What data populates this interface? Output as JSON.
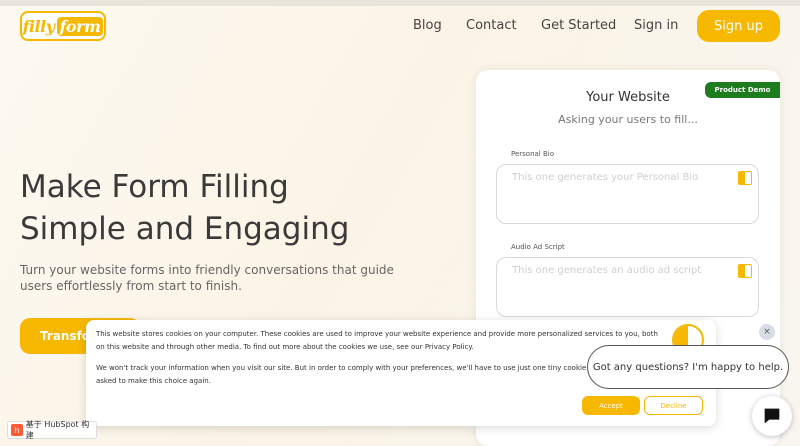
{
  "header": {
    "logo_left": "filly",
    "logo_right": "form",
    "nav": [
      "Blog",
      "Contact",
      "Get Started",
      "Sign in"
    ],
    "signup": "Sign up"
  },
  "hero": {
    "title_line1": "Make Form Filling",
    "title_line2": "Simple and Engaging",
    "subtitle": "Turn your website forms into friendly conversations that guide users effortlessly from start to finish.",
    "cta": "Transfor"
  },
  "demo": {
    "badge": "Product Demo",
    "title": "Your Website",
    "subtitle": "Asking your users to fill...",
    "fields": [
      {
        "label": "Personal Bio",
        "placeholder": "This one generates your Personal Bio"
      },
      {
        "label": "Audio Ad Script",
        "placeholder": "This one generates an audio ad script"
      }
    ]
  },
  "cookie": {
    "text1": "This website stores cookies on your computer. These cookies are used to improve your website experience and provide more personalized services to you, both on this website and through other media. To find out more about the cookies we use, see our Privacy Policy.",
    "text2": "We won't track your information when you visit our site. But in order to comply with your preferences, we'll have to use just one tiny cookie so that you're not asked to make this choice again.",
    "accept": "Accept",
    "decline": "Decline"
  },
  "chat": {
    "bubble": "Got any questions? I'm happy to help.",
    "close": "×"
  },
  "hubspot": {
    "label": "基于 HubSpot 构建"
  },
  "colors": {
    "accent": "#f6b800",
    "badge": "#1e7c1e"
  }
}
